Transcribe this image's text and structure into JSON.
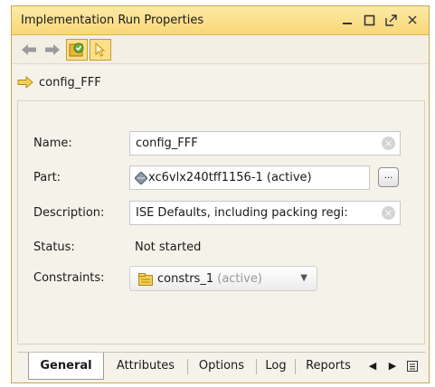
{
  "window": {
    "title": "Implementation Run Properties",
    "controls": [
      "minimize-icon",
      "maximize-icon",
      "float-icon",
      "close-icon"
    ]
  },
  "toolbar": {
    "buttons": [
      "back-arrow-icon",
      "forward-arrow-icon",
      "auto-update-icon",
      "select-pointer-icon"
    ]
  },
  "breadcrumb": {
    "text": "config_FFF"
  },
  "form": {
    "name_label": "Name:",
    "name_value": "config_FFF",
    "part_label": "Part:",
    "part_value": "xc6vlx240tff1156-1 (active)",
    "part_button": "...",
    "description_label": "Description:",
    "description_value": "ISE Defaults, including packing regi:",
    "status_label": "Status:",
    "status_value": "Not started",
    "constraints_label": "Constraints:",
    "constraints_value": "constrs_1",
    "constraints_suffix": "(active)"
  },
  "tabs": [
    "General",
    "Attributes",
    "Options",
    "Log",
    "Reports"
  ],
  "colors": {
    "title_bg": "#f8d877",
    "accent": "#e0a21a",
    "panel_bg": "#f5f2ea"
  }
}
